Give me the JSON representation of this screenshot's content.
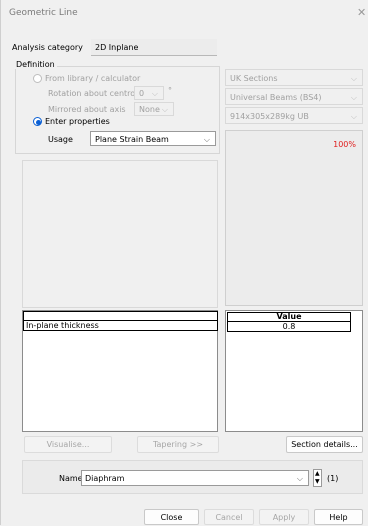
{
  "window": {
    "title": "Geometric Line"
  },
  "analysis": {
    "label": "Analysis category",
    "value": "2D Inplane"
  },
  "definition": {
    "group_label": "Definition",
    "from_library_label": "From library / calculator",
    "rotation_label": "Rotation about centroid",
    "rotation_value": "0",
    "rotation_unit": "°",
    "mirrored_label": "Mirrored about axis",
    "mirrored_value": "None",
    "enter_properties_label": "Enter properties",
    "usage_label": "Usage",
    "usage_value": "Plane Strain Beam"
  },
  "library": {
    "sections": "UK Sections",
    "family": "Universal Beams (BS4)",
    "size": "914x305x289kg UB",
    "zoom": "100%"
  },
  "properties_table": {
    "row_label": "In-plane thickness",
    "value_header": "Value",
    "value": "0.8"
  },
  "buttons": {
    "visualise": "Visualise...",
    "tapering": "Tapering >>",
    "section_details": "Section details...",
    "close": "Close",
    "cancel": "Cancel",
    "apply": "Apply",
    "help": "Help"
  },
  "name_row": {
    "label": "Name",
    "value": "Diaphram",
    "count": "(1)"
  }
}
